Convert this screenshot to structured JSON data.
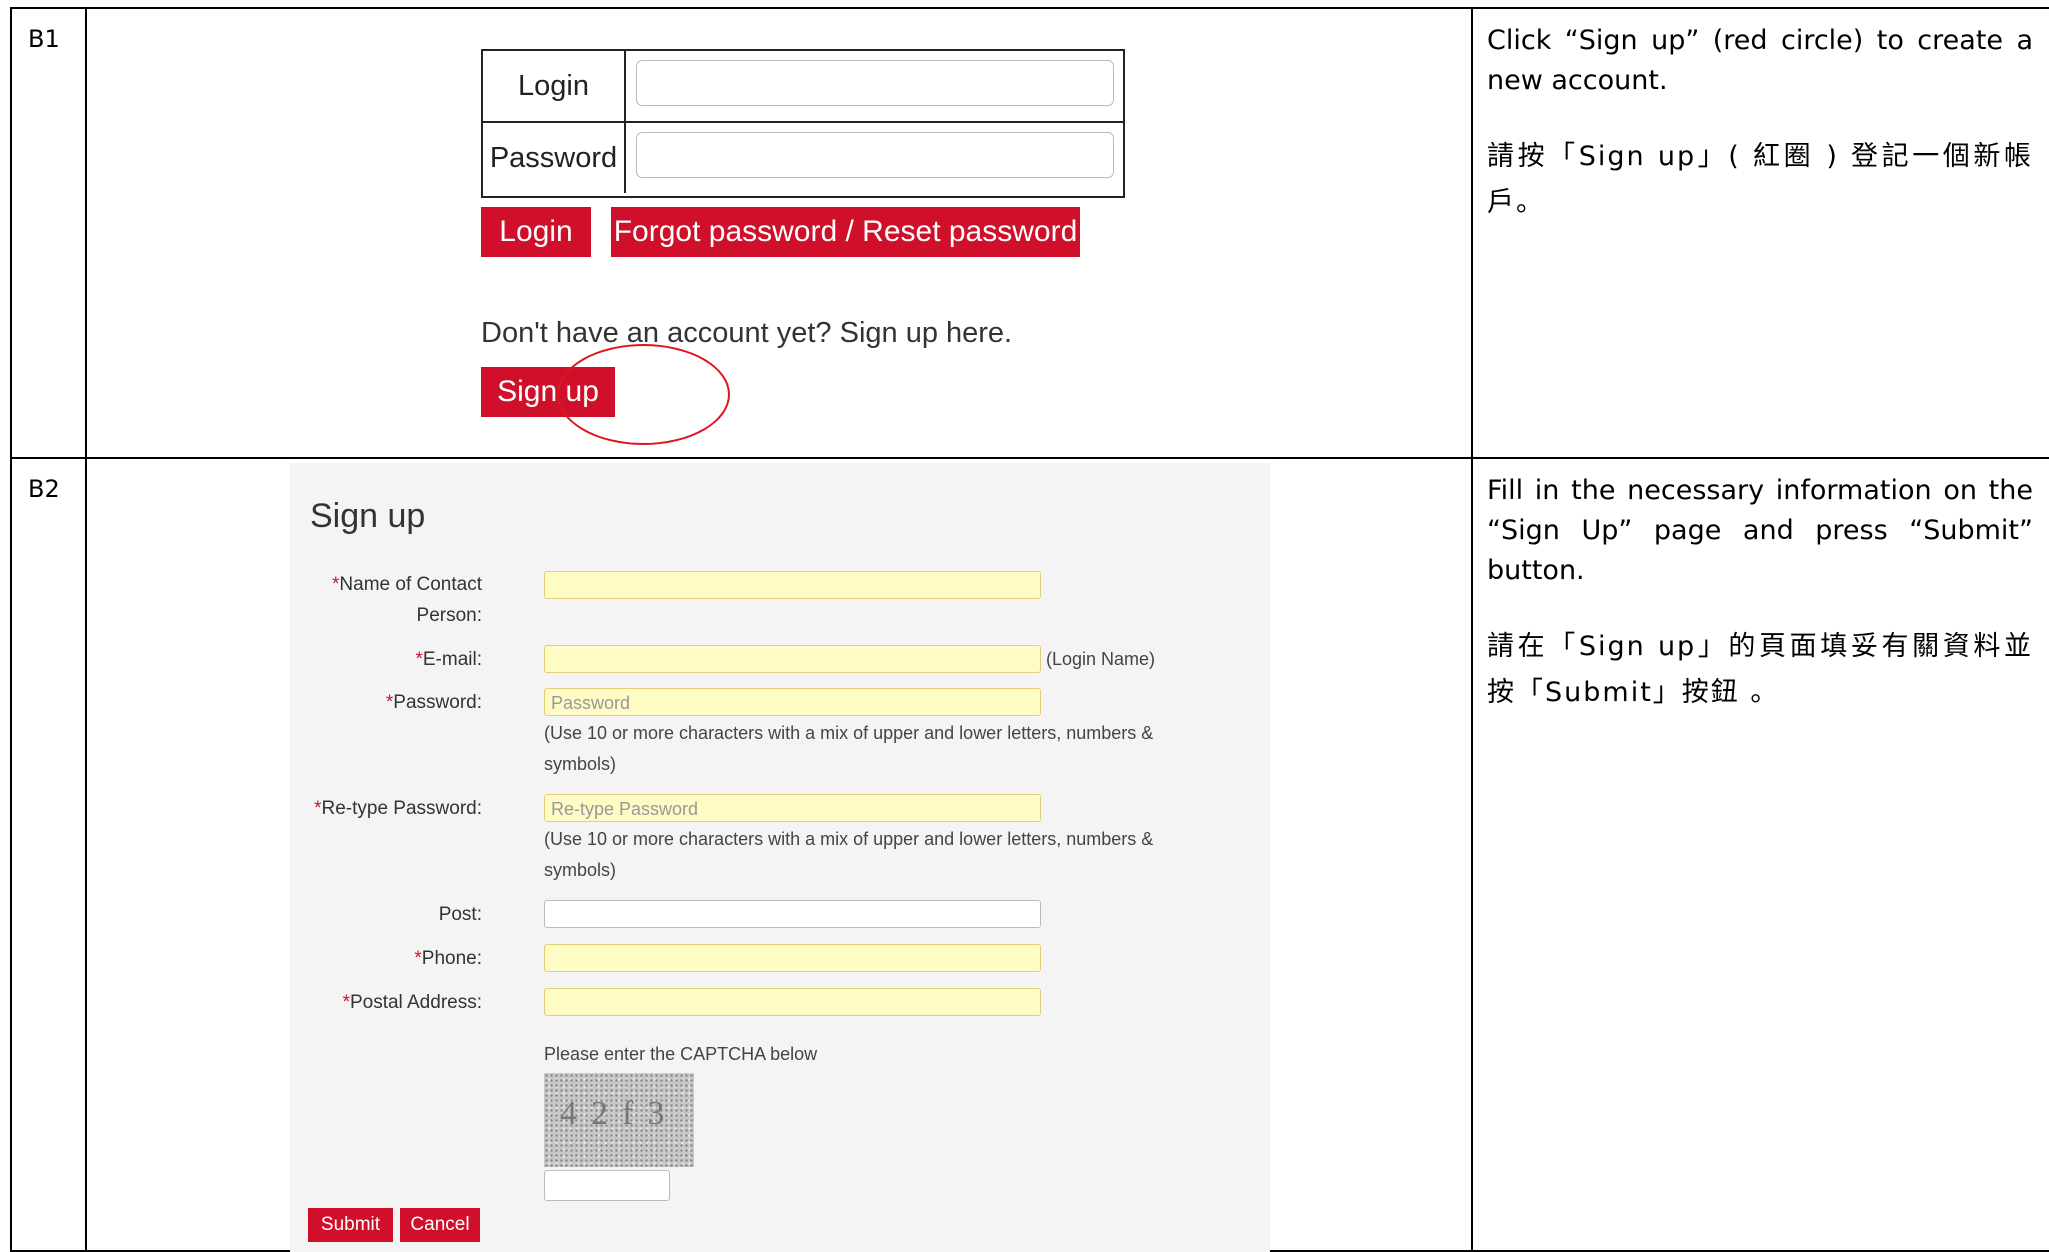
{
  "rows": [
    {
      "step": "B1",
      "desc_en": "Click “Sign up” (red circle) to create a new account.",
      "desc_zh": "請按「Sign up」( 紅圈 ) 登記一個新帳戶。"
    },
    {
      "step": "B2",
      "desc_en": "Fill in the necessary information on the “Sign Up” page and press “Submit” button.",
      "desc_zh": "請在「Sign up」的頁面填妥有關資料並按「Submit」按鈕 。"
    }
  ],
  "login": {
    "login_label": "Login",
    "password_label": "Password",
    "login_button": "Login",
    "forgot_button": "Forgot password / Reset password",
    "prompt": "Don't have an account yet? Sign up here.",
    "signup_button": "Sign up"
  },
  "signup": {
    "title": "Sign up",
    "req_mark": "*",
    "fields": {
      "contact_name": "Name of Contact",
      "contact_person": "Person:",
      "email": "E-mail:",
      "email_note": "(Login Name)",
      "password": "Password:",
      "password_placeholder": "Password",
      "password_note": "(Use 10 or more characters with a mix of upper and lower letters, numbers & symbols)",
      "retype": "Re-type Password:",
      "retype_placeholder": "Re-type Password",
      "retype_note": "(Use 10 or more characters with a mix of upper and lower letters, numbers & symbols)",
      "post": "Post:",
      "phone": "Phone:",
      "postal_address": "Postal Address:"
    },
    "captcha_prompt": "Please enter the CAPTCHA below",
    "captcha_text": "42f3",
    "submit_button": "Submit",
    "cancel_button": "Cancel"
  }
}
